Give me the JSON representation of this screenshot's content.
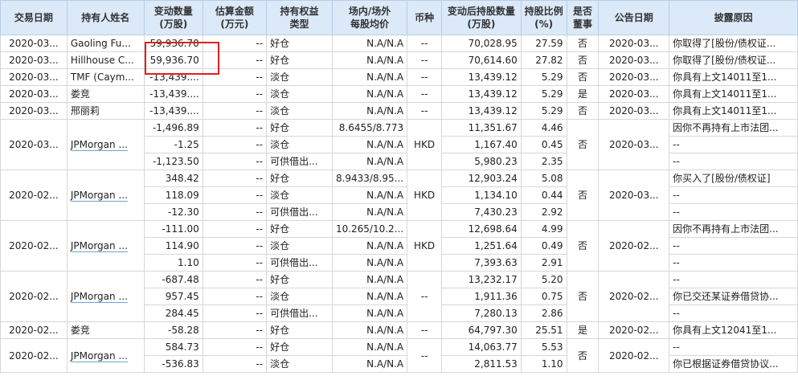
{
  "headers": {
    "date": "交易日期",
    "holder": "持有人姓名",
    "change": "变动数量\n(万股)",
    "amount": "估算金额\n(万元)",
    "type": "持有权益\n类型",
    "price": "场内/场外\n每股均价",
    "currency": "币种",
    "after": "变动后持股数量\n(万股)",
    "ratio": "持股比例\n(%)",
    "director": "是否\n董事",
    "announce": "公告日期",
    "reason": "披露原因"
  },
  "rows": [
    {
      "date": "2020-03...",
      "holder": "Gaoling Fu...",
      "change": "59,936.70",
      "amount": "--",
      "type": "好仓",
      "price": "N.A/N.A",
      "currency": "--",
      "after": "70,028.95",
      "ratio": "27.59",
      "director": "否",
      "announce": "2020-03...",
      "reason": "你取得了[股份/债权证..."
    },
    {
      "date": "2020-03...",
      "holder": "Hillhouse C...",
      "change": "59,936.70",
      "amount": "--",
      "type": "好仓",
      "price": "N.A/N.A",
      "currency": "--",
      "after": "70,614.60",
      "ratio": "27.82",
      "director": "否",
      "announce": "2020-03...",
      "reason": "你取得了[股份/债权证..."
    },
    {
      "date": "2020-03...",
      "holder": "TMF (Caym...",
      "change": "-13,439....",
      "amount": "--",
      "type": "淡仓",
      "price": "N.A/N.A",
      "currency": "--",
      "after": "13,439.12",
      "ratio": "5.29",
      "director": "否",
      "announce": "2020-03...",
      "reason": "你具有上文14011至1..."
    },
    {
      "date": "2020-03...",
      "holder": "娄竞",
      "change": "-13,439....",
      "amount": "--",
      "type": "淡仓",
      "price": "N.A/N.A",
      "currency": "--",
      "after": "13,439.12",
      "ratio": "5.29",
      "director": "是",
      "announce": "2020-03...",
      "reason": "你具有上文14011至1..."
    },
    {
      "date": "2020-03...",
      "holder": "邢丽莉",
      "change": "-13,439....",
      "amount": "--",
      "type": "淡仓",
      "price": "N.A/N.A",
      "currency": "--",
      "after": "13,439.12",
      "ratio": "5.29",
      "director": "否",
      "announce": "2020-03...",
      "reason": "你具有上文14011至1..."
    }
  ],
  "groups": [
    {
      "date": "2020-03...",
      "holder": "JPMorgan ...",
      "currency": "HKD",
      "director": "否",
      "announce": "2020-03...",
      "subrows": [
        {
          "change": "-1,496.89",
          "amount": "--",
          "type": "好仓",
          "price": "8.6455/8.773",
          "after": "11,351.67",
          "ratio": "4.46",
          "reason": "因你不再持有上市法团..."
        },
        {
          "change": "-1.25",
          "amount": "--",
          "type": "淡仓",
          "price": "N.A/N.A",
          "after": "1,167.40",
          "ratio": "0.45",
          "reason": "--"
        },
        {
          "change": "-1,123.50",
          "amount": "--",
          "type": "可供借出...",
          "price": "N.A/N.A",
          "after": "5,980.23",
          "ratio": "2.35",
          "reason": "--"
        }
      ]
    },
    {
      "date": "2020-02...",
      "holder": "JPMorgan ...",
      "currency": "HKD",
      "director": "否",
      "announce": "2020-03...",
      "subrows": [
        {
          "change": "348.42",
          "amount": "--",
          "type": "好仓",
          "price": "8.9433/8.95...",
          "after": "12,903.24",
          "ratio": "5.08",
          "reason": "你买入了[股份/债权证]"
        },
        {
          "change": "118.09",
          "amount": "--",
          "type": "淡仓",
          "price": "N.A/N.A",
          "after": "1,134.10",
          "ratio": "0.44",
          "reason": "--"
        },
        {
          "change": "-12.30",
          "amount": "--",
          "type": "可供借出...",
          "price": "N.A/N.A",
          "after": "7,430.23",
          "ratio": "2.92",
          "reason": "--"
        }
      ]
    },
    {
      "date": "2020-02...",
      "holder": "JPMorgan ...",
      "currency": "HKD",
      "director": "否",
      "announce": "2020-02...",
      "subrows": [
        {
          "change": "-111.00",
          "amount": "--",
          "type": "好仓",
          "price": "10.265/10.2...",
          "after": "12,698.64",
          "ratio": "4.99",
          "reason": "因你不再持有上市法团..."
        },
        {
          "change": "114.90",
          "amount": "--",
          "type": "淡仓",
          "price": "N.A/N.A",
          "after": "1,251.64",
          "ratio": "0.49",
          "reason": "--"
        },
        {
          "change": "1.10",
          "amount": "--",
          "type": "可供借出...",
          "price": "N.A/N.A",
          "after": "7,393.63",
          "ratio": "2.91",
          "reason": "--"
        }
      ]
    },
    {
      "date": "2020-02...",
      "holder": "JPMorgan ...",
      "currency": "--",
      "director": "否",
      "announce": "2020-02...",
      "subrows": [
        {
          "change": "-687.48",
          "amount": "--",
          "type": "好仓",
          "price": "N.A/N.A",
          "after": "13,232.17",
          "ratio": "5.20",
          "reason": "--"
        },
        {
          "change": "957.45",
          "amount": "--",
          "type": "淡仓",
          "price": "N.A/N.A",
          "after": "1,911.36",
          "ratio": "0.75",
          "reason": "你已交还某证券借贷协..."
        },
        {
          "change": "284.45",
          "amount": "--",
          "type": "可供借出...",
          "price": "N.A/N.A",
          "after": "7,280.13",
          "ratio": "2.86",
          "reason": "--"
        }
      ]
    }
  ],
  "single_row": {
    "date": "2020-02...",
    "holder": "娄竞",
    "change": "-58.28",
    "amount": "--",
    "type": "好仓",
    "price": "N.A/N.A",
    "currency": "--",
    "after": "64,797.30",
    "ratio": "25.51",
    "director": "是",
    "announce": "2020-02...",
    "reason": "你具有上文12041至1..."
  },
  "last_group": {
    "date": "2020-02...",
    "holder": "JPMorgan ...",
    "currency": "--",
    "director": "否",
    "announce": "2020-02...",
    "subrows": [
      {
        "change": "584.73",
        "amount": "--",
        "type": "好仓",
        "price": "N.A/N.A",
        "after": "14,063.77",
        "ratio": "5.53",
        "reason": "--"
      },
      {
        "change": "-536.83",
        "amount": "--",
        "type": "淡仓",
        "price": "N.A/N.A",
        "after": "2,811.53",
        "ratio": "1.10",
        "reason": "你已根据证券借贷协议..."
      }
    ]
  }
}
